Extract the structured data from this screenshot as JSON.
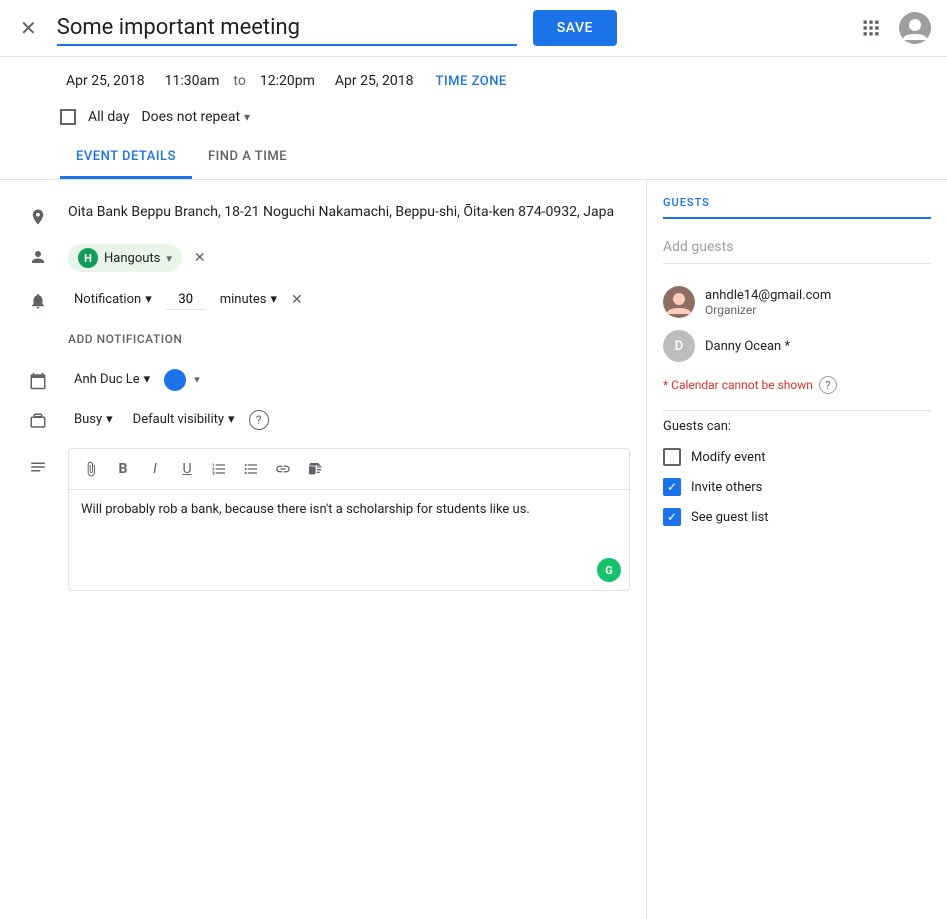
{
  "header": {
    "title": "Some important meeting",
    "save_label": "SAVE",
    "close_label": "✕"
  },
  "datetime": {
    "start_date": "Apr 25, 2018",
    "start_time": "11:30am",
    "to_label": "to",
    "end_time": "12:20pm",
    "end_date": "Apr 25, 2018",
    "timezone_label": "TIME ZONE"
  },
  "allday": {
    "label": "All day"
  },
  "repeat": {
    "label": "Does not repeat"
  },
  "tabs": {
    "event_details": "EVENT DETAILS",
    "find_a_time": "FIND A TIME"
  },
  "location": {
    "placeholder": "Oita Bank Beppu Branch, 18-21 Noguchi Nakamachi, Beppu-shi, Ōita-ken 874-0932, Japa"
  },
  "video_call": {
    "label": "Hangouts"
  },
  "notification": {
    "type": "Notification",
    "value": "30",
    "unit": "minutes"
  },
  "add_notification_label": "ADD NOTIFICATION",
  "calendar": {
    "name": "Anh Duc Le"
  },
  "status": {
    "label": "Busy",
    "visibility": "Default visibility"
  },
  "description": {
    "text": "Will probably rob a bank, because there isn't a scholarship for students like us."
  },
  "guests": {
    "title": "GUESTS",
    "add_placeholder": "Add guests",
    "organizer": {
      "email": "anhdle14@gmail.com",
      "role": "Organizer"
    },
    "guest": {
      "name": "Danny Ocean *"
    },
    "calendar_note": "* Calendar cannot be shown",
    "guests_can_label": "Guests can:",
    "permissions": [
      {
        "label": "Modify event",
        "checked": false
      },
      {
        "label": "Invite others",
        "checked": true
      },
      {
        "label": "See guest list",
        "checked": true
      }
    ]
  },
  "icons": {
    "close": "✕",
    "grid": "⠿",
    "account": "●",
    "location_pin": "📍",
    "person": "👤",
    "bell": "🔔",
    "calendar": "📅",
    "briefcase": "💼",
    "text": "≡",
    "attachment": "📎",
    "bold": "B",
    "italic": "I",
    "underline": "U",
    "ordered_list": "≡",
    "bullet_list": "≡",
    "link": "🔗",
    "remove_format": "✕",
    "chevron_down": "▾",
    "help": "?",
    "grammarly": "G"
  }
}
